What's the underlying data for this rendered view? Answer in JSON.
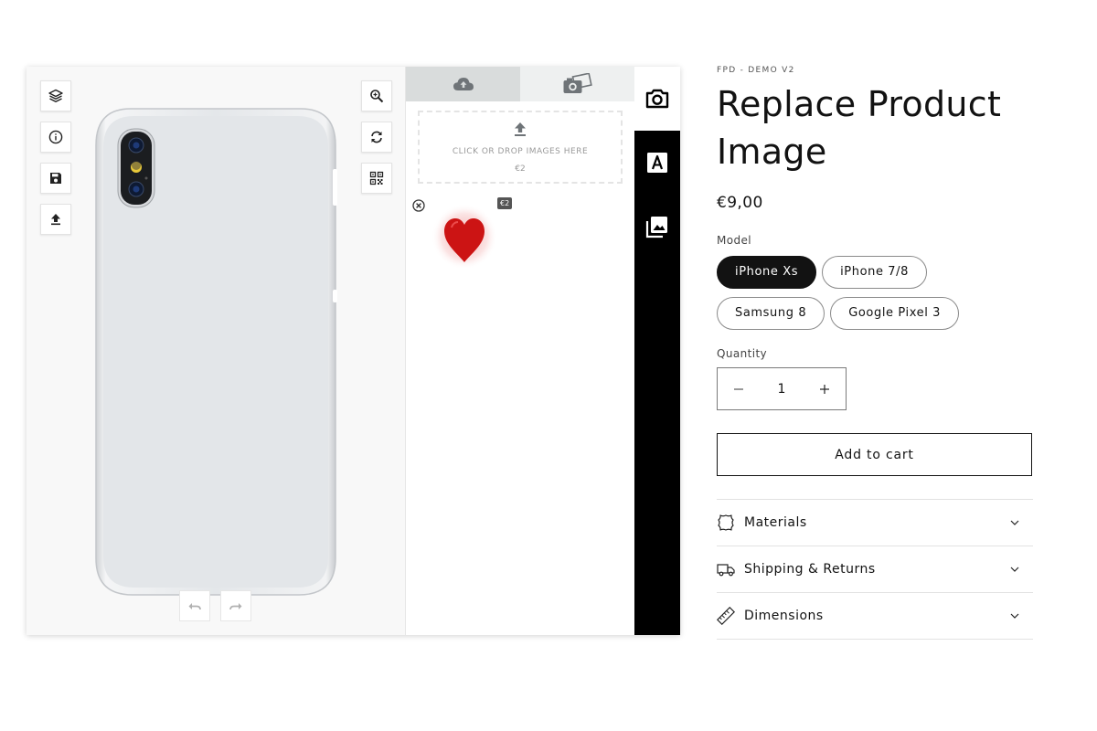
{
  "designer": {
    "tools_left": [
      {
        "icon": "layers-icon",
        "label": ""
      },
      {
        "icon": "info-icon",
        "label": ""
      },
      {
        "icon": "save-icon",
        "label": ""
      },
      {
        "icon": "upload-icon",
        "label": ""
      }
    ],
    "tools_right": [
      {
        "icon": "zoom-icon"
      },
      {
        "icon": "reset-icon"
      },
      {
        "icon": "qr-code-icon"
      }
    ],
    "history": [
      {
        "icon": "undo-icon"
      },
      {
        "icon": "redo-icon"
      }
    ],
    "module": {
      "tabs": [
        {
          "icon": "cloud-upload-icon",
          "active": true
        },
        {
          "icon": "photos-icon",
          "active": false
        }
      ],
      "dropzone_text": "CLICK OR DROP IMAGES HERE",
      "dropzone_price": "€2",
      "thumbnail": {
        "icon": "heart-image",
        "price": "€2"
      }
    },
    "sidenav": [
      {
        "icon": "camera-icon",
        "active": true
      },
      {
        "icon": "text-icon",
        "active": false
      },
      {
        "icon": "images-icon",
        "active": false
      }
    ]
  },
  "product": {
    "vendor": "FPD - DEMO V2",
    "title_line1": "Replace Product",
    "title_line2": "Image",
    "price": "€9,00",
    "model_label": "Model",
    "models": [
      "iPhone Xs",
      "iPhone 7/8",
      "Samsung 8",
      "Google Pixel 3"
    ],
    "selected_model": "iPhone Xs",
    "quantity_label": "Quantity",
    "quantity": "1",
    "add_to_cart": "Add to cart",
    "accordion": [
      {
        "label": "Materials",
        "icon": "leather-icon"
      },
      {
        "label": "Shipping & Returns",
        "icon": "truck-icon"
      },
      {
        "label": "Dimensions",
        "icon": "ruler-icon"
      }
    ]
  },
  "colors": {
    "accent": "#121212",
    "sidenav": "#000000",
    "heart": "#cc1414"
  }
}
